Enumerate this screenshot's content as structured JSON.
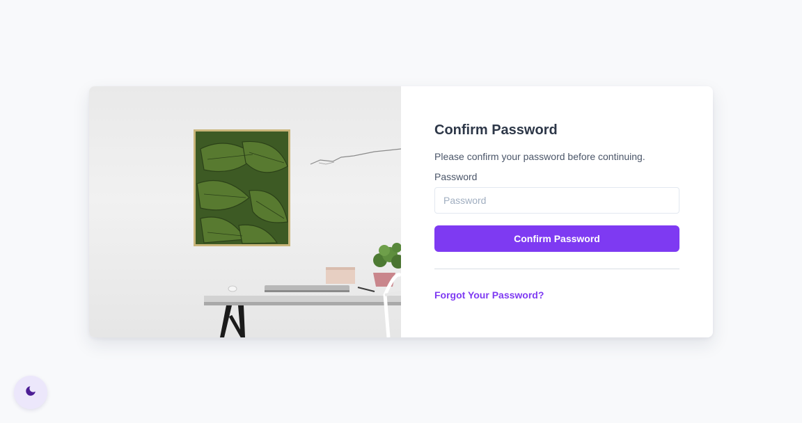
{
  "form": {
    "title": "Confirm Password",
    "description": "Please confirm your password before continuing.",
    "password_label": "Password",
    "password_placeholder": "Password",
    "password_value": "",
    "submit_label": "Confirm Password",
    "forgot_link": "Forgot Your Password?"
  },
  "theme_toggle": {
    "icon": "moon-icon"
  },
  "colors": {
    "accent": "#7e3af2",
    "page_background": "#f8f9fb",
    "card_background": "#ffffff",
    "title_text": "#2d3748",
    "body_text": "#4a5568",
    "toggle_background": "#ece7fb",
    "moon": "#4c1d95"
  }
}
